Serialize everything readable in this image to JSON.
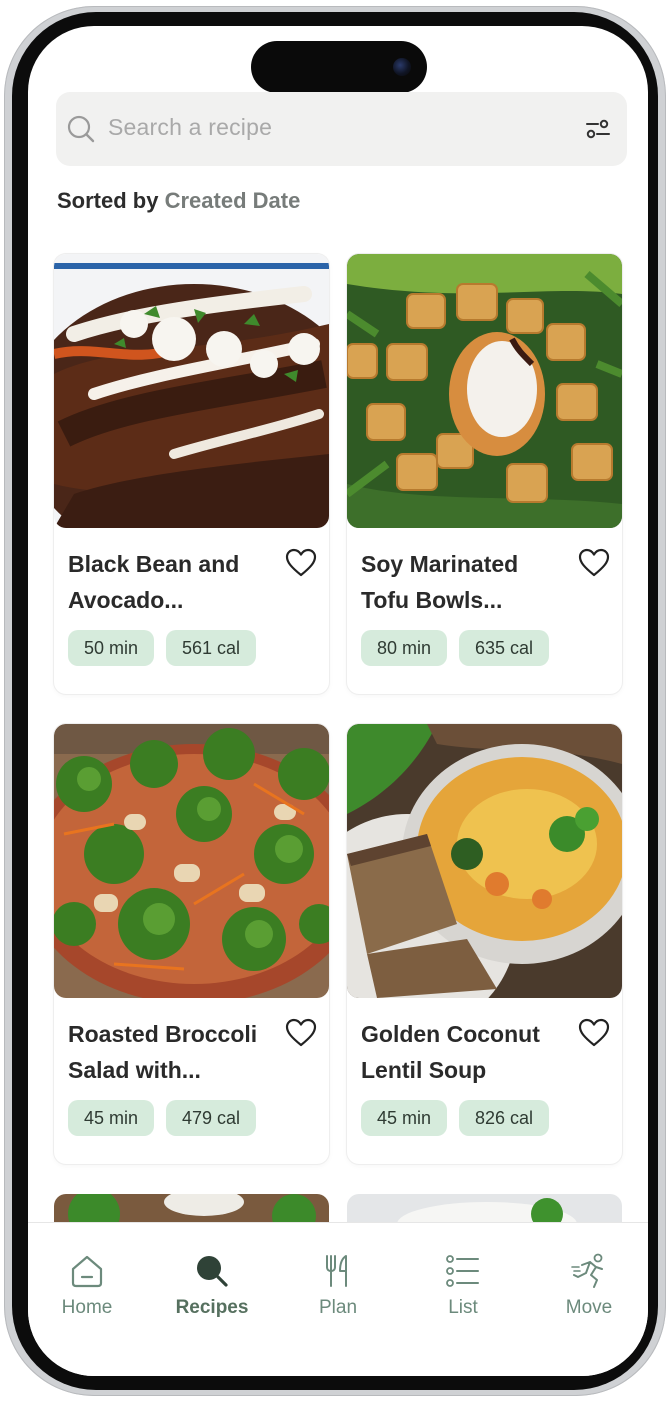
{
  "search": {
    "placeholder": "Search a recipe",
    "icon": "search-icon",
    "filter_icon": "filter-sliders-icon"
  },
  "sort": {
    "prefix": "Sorted by",
    "value": "Created Date"
  },
  "recipes": [
    {
      "title": "Black Bean and Avocado...",
      "time": "50 min",
      "calories": "561 cal",
      "image": "enchiladas-photo"
    },
    {
      "title": "Soy Marinated Tofu Bowls...",
      "time": "80 min",
      "calories": "635 cal",
      "image": "tofu-bowl-photo"
    },
    {
      "title": "Roasted Broccoli Salad with...",
      "time": "45 min",
      "calories": "479 cal",
      "image": "broccoli-salad-photo"
    },
    {
      "title": "Golden Coconut Lentil Soup",
      "time": "45 min",
      "calories": "826 cal",
      "image": "lentil-soup-photo"
    }
  ],
  "tabs": [
    {
      "label": "Home",
      "icon": "home-icon",
      "active": false
    },
    {
      "label": "Recipes",
      "icon": "search-icon",
      "active": true
    },
    {
      "label": "Plan",
      "icon": "fork-knife-icon",
      "active": false
    },
    {
      "label": "List",
      "icon": "list-icon",
      "active": false
    },
    {
      "label": "Move",
      "icon": "running-icon",
      "active": false
    }
  ],
  "colors": {
    "accent": "#56705f",
    "chip_bg": "#d6ebdc",
    "tab_inactive": "#6c8a7c",
    "search_bg": "#f1f1f0"
  }
}
